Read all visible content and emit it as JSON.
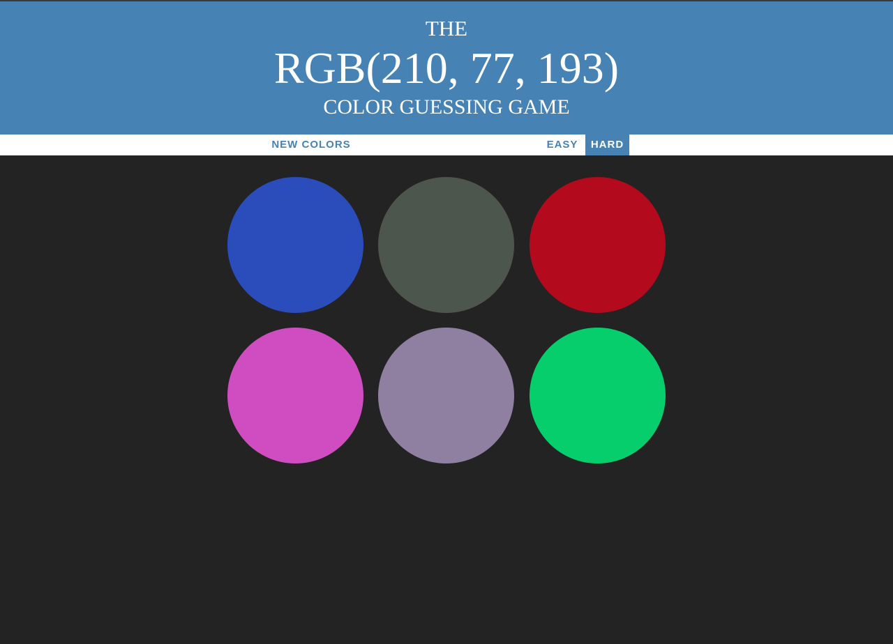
{
  "header": {
    "line_top": "THE",
    "rgb_display": "RGB(210, 77, 193)",
    "line_bottom": "COLOR GUESSING GAME"
  },
  "controls": {
    "new_colors_label": "NEW COLORS",
    "message": "",
    "modes": [
      {
        "label": "EASY",
        "selected": false
      },
      {
        "label": "HARD",
        "selected": true
      }
    ]
  },
  "theme": {
    "header_color": "#4682b4",
    "background": "#232323",
    "stripe": "#ffffff"
  },
  "squares": [
    {
      "color": "#2b4dbc"
    },
    {
      "color": "#4d564c"
    },
    {
      "color": "#b40a1e"
    },
    {
      "color": "#d04dc1"
    },
    {
      "color": "#8f80a1"
    },
    {
      "color": "#07ce6d"
    }
  ]
}
